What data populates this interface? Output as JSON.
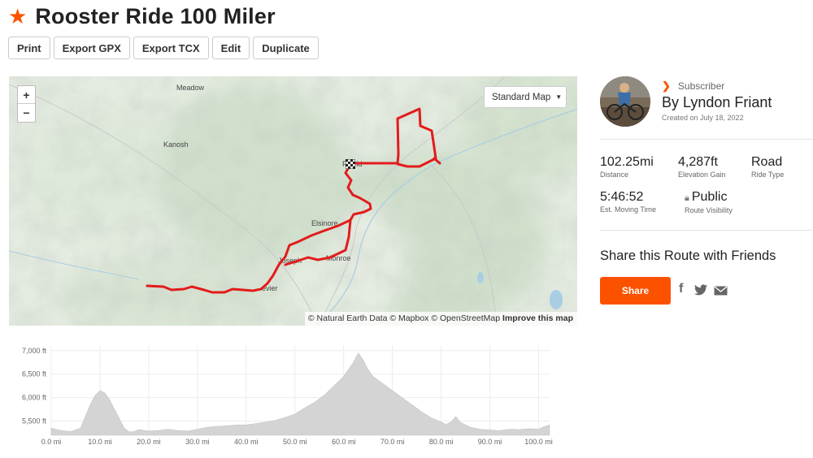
{
  "route": {
    "title": "Rooster Ride 100 Miler",
    "star_icon": "star-icon"
  },
  "toolbar": {
    "print": "Print",
    "export_gpx": "Export GPX",
    "export_tcx": "Export TCX",
    "edit": "Edit",
    "duplicate": "Duplicate"
  },
  "map": {
    "zoom_in": "+",
    "zoom_out": "−",
    "map_type": "Standard Map",
    "attribution": "© Natural Earth Data © Mapbox © OpenStreetMap",
    "improve": "Improve this map",
    "towns": {
      "meadow": "Meadow",
      "kanosh": "Kanosh",
      "fairfield": "F   field",
      "elsinore": "Elsinore",
      "joseph": "Joseph",
      "monroe": "Monroe",
      "sevier": "evier"
    },
    "route_color": "#e31b1b"
  },
  "athlete": {
    "subscriber_label": "Subscriber",
    "name": "By Lyndon Friant",
    "created": "Created on July 18, 2022"
  },
  "stats": {
    "distance_value": "102.25mi",
    "distance_label": "Distance",
    "elevation_value": "4,287ft",
    "elevation_label": "Elevation Gain",
    "ride_type_value": "Road",
    "ride_type_label": "Ride Type",
    "moving_time_value": "5:46:52",
    "moving_time_label": "Est. Moving Time",
    "visibility_value": "Public",
    "visibility_label": "Route Visibility"
  },
  "share": {
    "title": "Share this Route with Friends",
    "button": "Share",
    "facebook_icon": "facebook-icon",
    "twitter_icon": "twitter-icon",
    "email_icon": "email-icon"
  },
  "colors": {
    "accent": "#fc5200",
    "route": "#e31b1b",
    "elevation_fill": "#d4d4d4"
  },
  "chart_data": {
    "type": "area",
    "title": "",
    "xlabel": "",
    "ylabel": "",
    "x_ticks": [
      "0.0 mi",
      "10.0 mi",
      "20.0 mi",
      "30.0 mi",
      "40.0 mi",
      "50.0 mi",
      "60.0 mi",
      "70.0 mi",
      "80.0 mi",
      "90.0 mi",
      "100.0 mi"
    ],
    "y_ticks": [
      "7,000 ft",
      "6,500 ft",
      "6,000 ft",
      "5,500 ft"
    ],
    "xlim": [
      0,
      102.25
    ],
    "ylim": [
      5200,
      7100
    ],
    "grid": true,
    "series": [
      {
        "x": [
          0,
          2,
          4,
          6,
          7,
          8,
          9,
          10,
          11,
          12,
          13,
          14,
          15,
          16,
          17,
          18,
          20,
          22,
          24,
          26,
          28,
          30,
          32,
          34,
          36,
          38,
          40,
          42,
          44,
          46,
          48,
          50,
          52,
          54,
          56,
          58,
          60,
          61,
          62,
          63,
          64,
          65,
          66,
          68,
          70,
          72,
          74,
          76,
          78,
          80,
          81,
          82,
          83,
          84,
          86,
          88,
          90,
          92,
          94,
          96,
          98,
          100,
          101,
          102.25
        ],
        "y": [
          5350,
          5300,
          5280,
          5350,
          5600,
          5850,
          6050,
          6150,
          6100,
          5950,
          5750,
          5550,
          5350,
          5270,
          5280,
          5320,
          5290,
          5300,
          5330,
          5300,
          5290,
          5330,
          5370,
          5390,
          5400,
          5420,
          5420,
          5450,
          5480,
          5520,
          5580,
          5650,
          5780,
          5900,
          6050,
          6250,
          6450,
          6600,
          6750,
          6950,
          6800,
          6600,
          6450,
          6300,
          6150,
          6000,
          5850,
          5700,
          5570,
          5480,
          5430,
          5480,
          5600,
          5470,
          5370,
          5330,
          5310,
          5300,
          5330,
          5320,
          5340,
          5330,
          5380,
          5420
        ]
      }
    ]
  }
}
